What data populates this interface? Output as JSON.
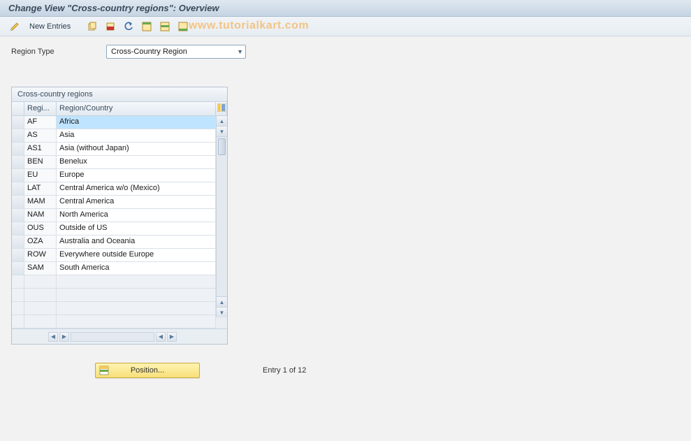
{
  "title": "Change View \"Cross-country regions\": Overview",
  "watermark": "www.tutorialkart.com",
  "toolbar": {
    "new_entries_label": "New Entries"
  },
  "field": {
    "label": "Region Type",
    "value": "Cross-Country Region"
  },
  "table": {
    "title": "Cross-country regions",
    "col_regi": "Regi...",
    "col_country": "Region/Country",
    "rows": [
      {
        "code": "AF",
        "name": "Africa",
        "selected": true
      },
      {
        "code": "AS",
        "name": "Asia"
      },
      {
        "code": "AS1",
        "name": "Asia (without Japan)"
      },
      {
        "code": "BEN",
        "name": "Benelux"
      },
      {
        "code": "EU",
        "name": "Europe"
      },
      {
        "code": "LAT",
        "name": "Central America w/o (Mexico)"
      },
      {
        "code": "MAM",
        "name": "Central America"
      },
      {
        "code": "NAM",
        "name": "North America"
      },
      {
        "code": "OUS",
        "name": "Outside of US"
      },
      {
        "code": "OZA",
        "name": "Australia and Oceania"
      },
      {
        "code": "ROW",
        "name": "Everywhere outside Europe"
      },
      {
        "code": "SAM",
        "name": "South America"
      }
    ],
    "empty_rows": 4
  },
  "footer": {
    "position_label": "Position...",
    "entry_text": "Entry 1 of 12"
  }
}
